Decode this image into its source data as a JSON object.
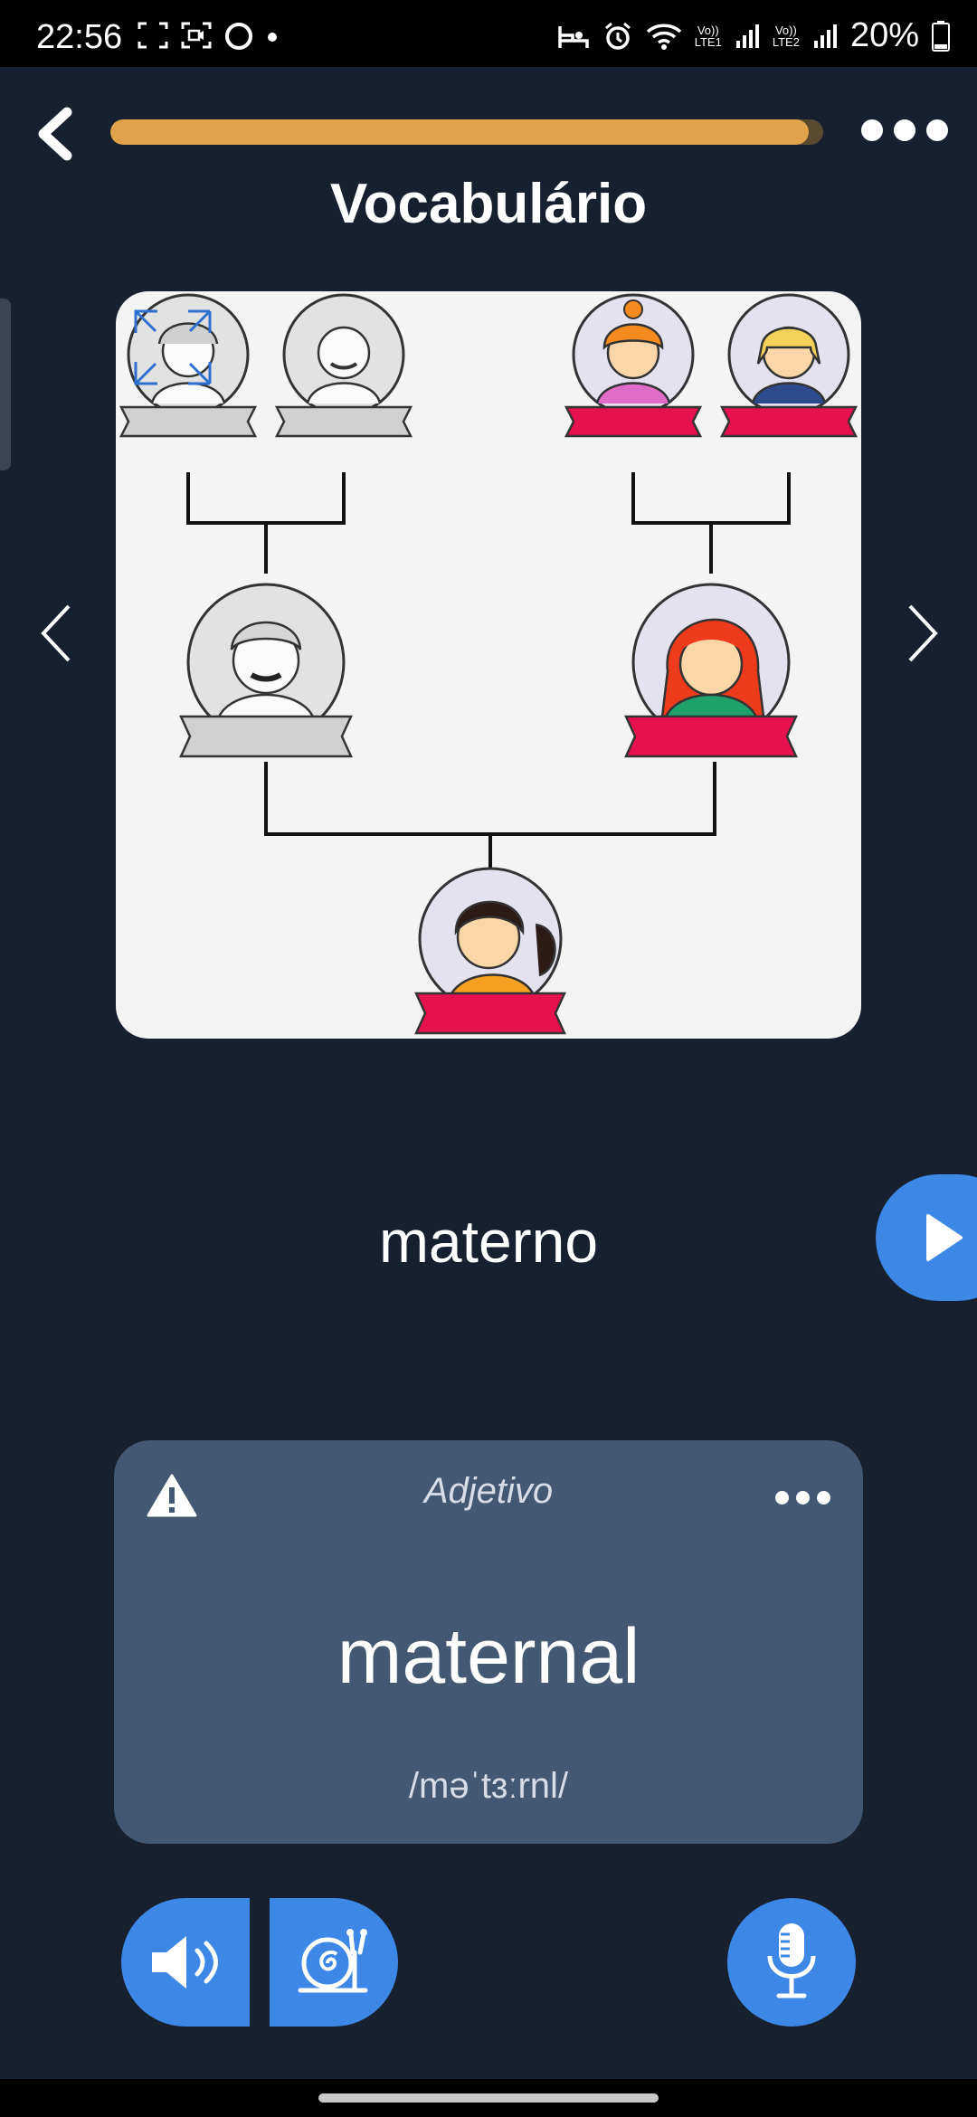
{
  "status_bar": {
    "time": "22:56",
    "battery": "20%",
    "sim1": "LTE1",
    "sim2": "LTE2",
    "volte": "Vo))"
  },
  "header": {
    "title": "Vocabulário",
    "progress_fraction": 0.98,
    "progress_color": "#e0a24a"
  },
  "flashcard": {
    "word": "materno",
    "image_icon": "family-tree-illustration"
  },
  "translation": {
    "part_of_speech": "Adjetivo",
    "word": "maternal",
    "pronunciation": "/məˈtɜːrnl/"
  },
  "colors": {
    "background": "#16202f",
    "card": "#435873",
    "accent_blue": "#3d87e6",
    "highlight_ribbon": "#e8114f"
  },
  "icons": {
    "back": "chevron-left-icon",
    "more": "more-horizontal-icon",
    "prev": "chevron-left-icon",
    "next": "chevron-right-icon",
    "play": "play-icon",
    "warning": "warning-icon",
    "audio": "speaker-icon",
    "slow_audio": "snail-icon",
    "record": "microphone-icon",
    "expand": "expand-icon"
  }
}
